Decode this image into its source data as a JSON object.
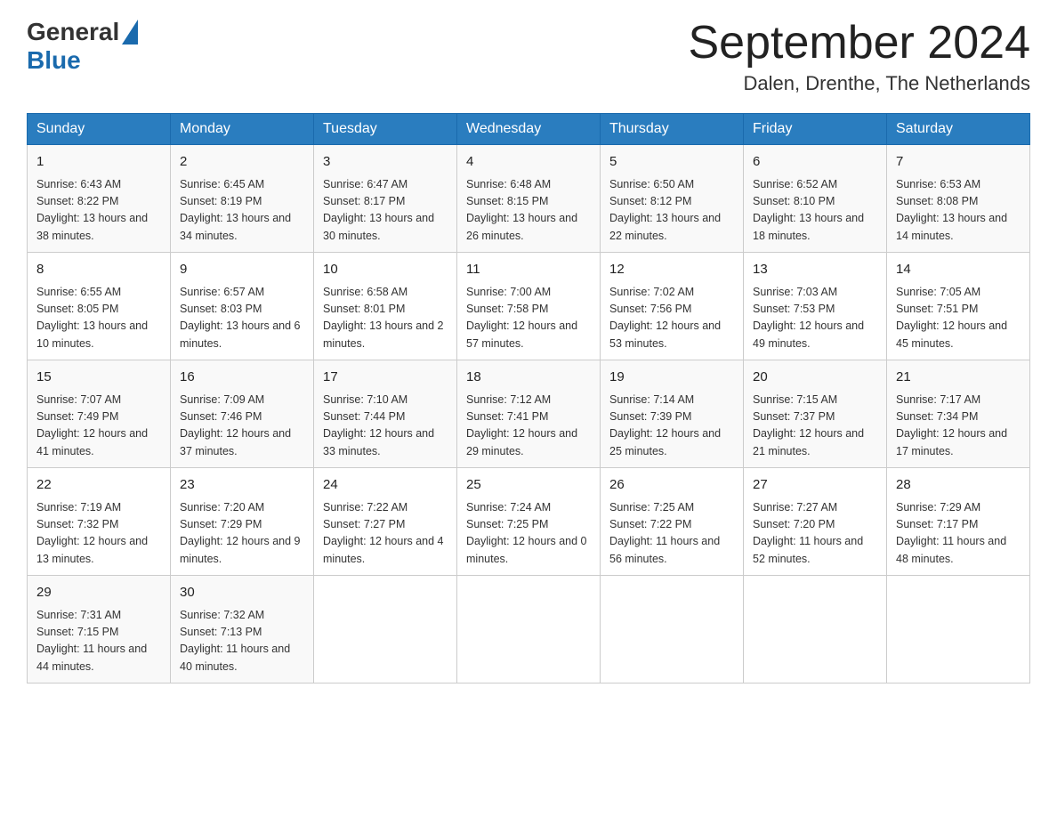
{
  "header": {
    "logo": {
      "general": "General",
      "blue": "Blue"
    },
    "title": "September 2024",
    "location": "Dalen, Drenthe, The Netherlands"
  },
  "days_of_week": [
    "Sunday",
    "Monday",
    "Tuesday",
    "Wednesday",
    "Thursday",
    "Friday",
    "Saturday"
  ],
  "weeks": [
    [
      {
        "day": "1",
        "sunrise": "Sunrise: 6:43 AM",
        "sunset": "Sunset: 8:22 PM",
        "daylight": "Daylight: 13 hours and 38 minutes."
      },
      {
        "day": "2",
        "sunrise": "Sunrise: 6:45 AM",
        "sunset": "Sunset: 8:19 PM",
        "daylight": "Daylight: 13 hours and 34 minutes."
      },
      {
        "day": "3",
        "sunrise": "Sunrise: 6:47 AM",
        "sunset": "Sunset: 8:17 PM",
        "daylight": "Daylight: 13 hours and 30 minutes."
      },
      {
        "day": "4",
        "sunrise": "Sunrise: 6:48 AM",
        "sunset": "Sunset: 8:15 PM",
        "daylight": "Daylight: 13 hours and 26 minutes."
      },
      {
        "day": "5",
        "sunrise": "Sunrise: 6:50 AM",
        "sunset": "Sunset: 8:12 PM",
        "daylight": "Daylight: 13 hours and 22 minutes."
      },
      {
        "day": "6",
        "sunrise": "Sunrise: 6:52 AM",
        "sunset": "Sunset: 8:10 PM",
        "daylight": "Daylight: 13 hours and 18 minutes."
      },
      {
        "day": "7",
        "sunrise": "Sunrise: 6:53 AM",
        "sunset": "Sunset: 8:08 PM",
        "daylight": "Daylight: 13 hours and 14 minutes."
      }
    ],
    [
      {
        "day": "8",
        "sunrise": "Sunrise: 6:55 AM",
        "sunset": "Sunset: 8:05 PM",
        "daylight": "Daylight: 13 hours and 10 minutes."
      },
      {
        "day": "9",
        "sunrise": "Sunrise: 6:57 AM",
        "sunset": "Sunset: 8:03 PM",
        "daylight": "Daylight: 13 hours and 6 minutes."
      },
      {
        "day": "10",
        "sunrise": "Sunrise: 6:58 AM",
        "sunset": "Sunset: 8:01 PM",
        "daylight": "Daylight: 13 hours and 2 minutes."
      },
      {
        "day": "11",
        "sunrise": "Sunrise: 7:00 AM",
        "sunset": "Sunset: 7:58 PM",
        "daylight": "Daylight: 12 hours and 57 minutes."
      },
      {
        "day": "12",
        "sunrise": "Sunrise: 7:02 AM",
        "sunset": "Sunset: 7:56 PM",
        "daylight": "Daylight: 12 hours and 53 minutes."
      },
      {
        "day": "13",
        "sunrise": "Sunrise: 7:03 AM",
        "sunset": "Sunset: 7:53 PM",
        "daylight": "Daylight: 12 hours and 49 minutes."
      },
      {
        "day": "14",
        "sunrise": "Sunrise: 7:05 AM",
        "sunset": "Sunset: 7:51 PM",
        "daylight": "Daylight: 12 hours and 45 minutes."
      }
    ],
    [
      {
        "day": "15",
        "sunrise": "Sunrise: 7:07 AM",
        "sunset": "Sunset: 7:49 PM",
        "daylight": "Daylight: 12 hours and 41 minutes."
      },
      {
        "day": "16",
        "sunrise": "Sunrise: 7:09 AM",
        "sunset": "Sunset: 7:46 PM",
        "daylight": "Daylight: 12 hours and 37 minutes."
      },
      {
        "day": "17",
        "sunrise": "Sunrise: 7:10 AM",
        "sunset": "Sunset: 7:44 PM",
        "daylight": "Daylight: 12 hours and 33 minutes."
      },
      {
        "day": "18",
        "sunrise": "Sunrise: 7:12 AM",
        "sunset": "Sunset: 7:41 PM",
        "daylight": "Daylight: 12 hours and 29 minutes."
      },
      {
        "day": "19",
        "sunrise": "Sunrise: 7:14 AM",
        "sunset": "Sunset: 7:39 PM",
        "daylight": "Daylight: 12 hours and 25 minutes."
      },
      {
        "day": "20",
        "sunrise": "Sunrise: 7:15 AM",
        "sunset": "Sunset: 7:37 PM",
        "daylight": "Daylight: 12 hours and 21 minutes."
      },
      {
        "day": "21",
        "sunrise": "Sunrise: 7:17 AM",
        "sunset": "Sunset: 7:34 PM",
        "daylight": "Daylight: 12 hours and 17 minutes."
      }
    ],
    [
      {
        "day": "22",
        "sunrise": "Sunrise: 7:19 AM",
        "sunset": "Sunset: 7:32 PM",
        "daylight": "Daylight: 12 hours and 13 minutes."
      },
      {
        "day": "23",
        "sunrise": "Sunrise: 7:20 AM",
        "sunset": "Sunset: 7:29 PM",
        "daylight": "Daylight: 12 hours and 9 minutes."
      },
      {
        "day": "24",
        "sunrise": "Sunrise: 7:22 AM",
        "sunset": "Sunset: 7:27 PM",
        "daylight": "Daylight: 12 hours and 4 minutes."
      },
      {
        "day": "25",
        "sunrise": "Sunrise: 7:24 AM",
        "sunset": "Sunset: 7:25 PM",
        "daylight": "Daylight: 12 hours and 0 minutes."
      },
      {
        "day": "26",
        "sunrise": "Sunrise: 7:25 AM",
        "sunset": "Sunset: 7:22 PM",
        "daylight": "Daylight: 11 hours and 56 minutes."
      },
      {
        "day": "27",
        "sunrise": "Sunrise: 7:27 AM",
        "sunset": "Sunset: 7:20 PM",
        "daylight": "Daylight: 11 hours and 52 minutes."
      },
      {
        "day": "28",
        "sunrise": "Sunrise: 7:29 AM",
        "sunset": "Sunset: 7:17 PM",
        "daylight": "Daylight: 11 hours and 48 minutes."
      }
    ],
    [
      {
        "day": "29",
        "sunrise": "Sunrise: 7:31 AM",
        "sunset": "Sunset: 7:15 PM",
        "daylight": "Daylight: 11 hours and 44 minutes."
      },
      {
        "day": "30",
        "sunrise": "Sunrise: 7:32 AM",
        "sunset": "Sunset: 7:13 PM",
        "daylight": "Daylight: 11 hours and 40 minutes."
      },
      null,
      null,
      null,
      null,
      null
    ]
  ]
}
